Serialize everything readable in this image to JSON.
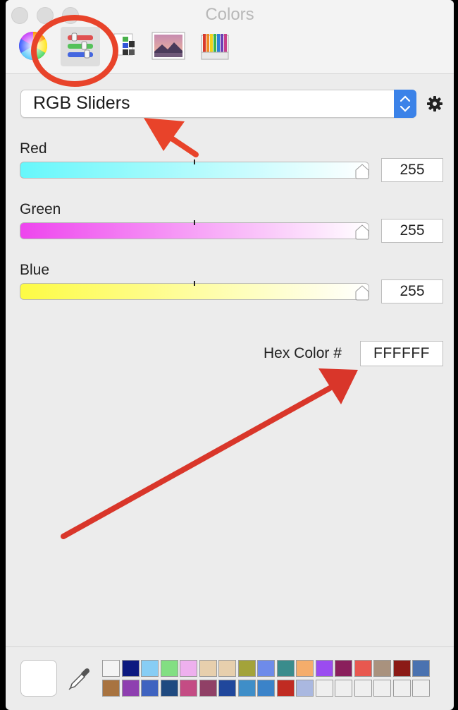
{
  "window": {
    "title": "Colors"
  },
  "toolbar": {
    "tools": [
      {
        "name": "color-wheel"
      },
      {
        "name": "color-sliders",
        "active": true
      },
      {
        "name": "color-palettes"
      },
      {
        "name": "image-palettes"
      },
      {
        "name": "pencils"
      }
    ]
  },
  "mode": {
    "selected": "RGB Sliders"
  },
  "sliders": [
    {
      "label": "Red",
      "value": "255",
      "gradient": [
        "#66f7fb",
        "#ffffff"
      ]
    },
    {
      "label": "Green",
      "value": "255",
      "gradient": [
        "#ee44ee",
        "#ffffff"
      ]
    },
    {
      "label": "Blue",
      "value": "255",
      "gradient": [
        "#fdfb44",
        "#ffffff"
      ]
    }
  ],
  "hex": {
    "label": "Hex Color #",
    "value": "FFFFFF"
  },
  "current_color": "#ffffff",
  "swatches": {
    "row1": [
      "#f4f4f4",
      "#0d1a80",
      "#87cdf4",
      "#82df82",
      "#eeb0ee",
      "#e7cfad",
      "#e7cfad",
      "#a3a33a",
      "#6e8bea",
      "#3a8c8c",
      "#f5ad6b",
      "#9b4cf0",
      "#8a1f5c",
      "#e8584f",
      "#a9927e",
      "#8b1a16",
      "#4a72b0"
    ],
    "row2": [
      "#a87340",
      "#8e3fb0",
      "#3f63c0",
      "#1f4a80",
      "#c44c84",
      "#904066",
      "#20479c",
      "#3f8ec8",
      "#3b83c9",
      "#c02b22",
      "#aab8e0",
      "#efefef",
      "#efefef",
      "#efefef",
      "#efefef",
      "#efefef",
      "#efefef"
    ]
  },
  "annotation_color": "#e8432a"
}
